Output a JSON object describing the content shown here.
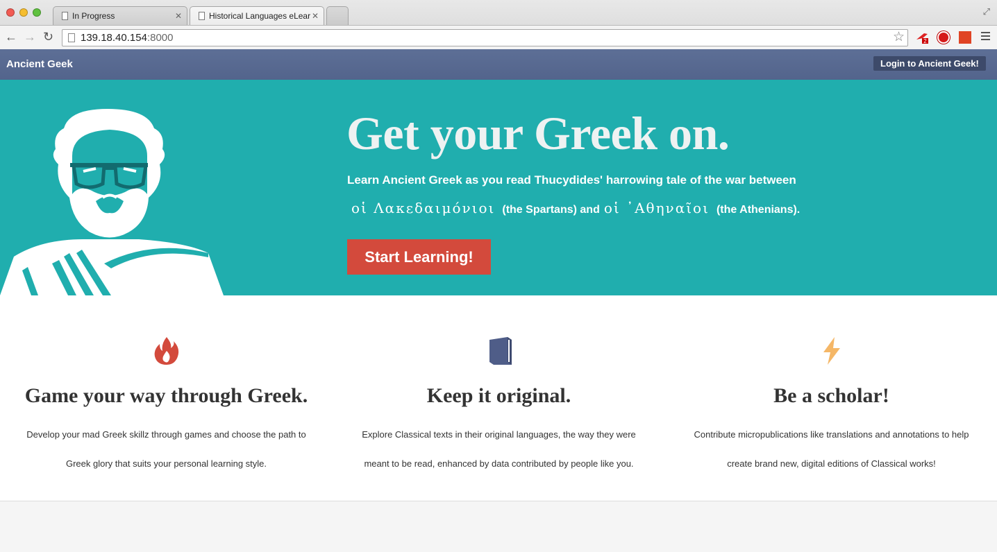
{
  "browser": {
    "tabs": [
      {
        "title": "In Progress"
      },
      {
        "title": "Historical Languages eLear"
      }
    ],
    "url_host": "139.18.40.154",
    "url_port": ":8000",
    "extension_badge": "2"
  },
  "nav": {
    "brand": "Ancient Geek",
    "login_label": "Login to Ancient Geek!"
  },
  "hero": {
    "title": "Get your Greek on.",
    "line1": "Learn Ancient Greek as you read Thucydides' harrowing tale of the war between",
    "greek1": "οἱ Λακεδαιμόνιοι",
    "gloss1": "(the Spartans) and",
    "greek2": "οἱ ᾿Αθηναῖοι",
    "gloss2": "(the Athenians).",
    "cta_label": "Start Learning!",
    "bg_color": "#20aeae"
  },
  "features": [
    {
      "icon": "flame-icon",
      "title": "Game your way through Greek.",
      "text": "Develop your mad Greek skillz through games and choose the path to Greek glory that suits your personal learning style.",
      "color": "#d34a3c"
    },
    {
      "icon": "book-icon",
      "title": "Keep it original.",
      "text": "Explore Classical texts in their original languages, the way they were meant to be read, enhanced by data contributed by people like you.",
      "color": "#4f5d88"
    },
    {
      "icon": "lightning-icon",
      "title": "Be a scholar!",
      "text": "Contribute micropublications like translations and annotations to help create brand new, digital editions of Classical works!",
      "color": "#f5b767"
    }
  ]
}
